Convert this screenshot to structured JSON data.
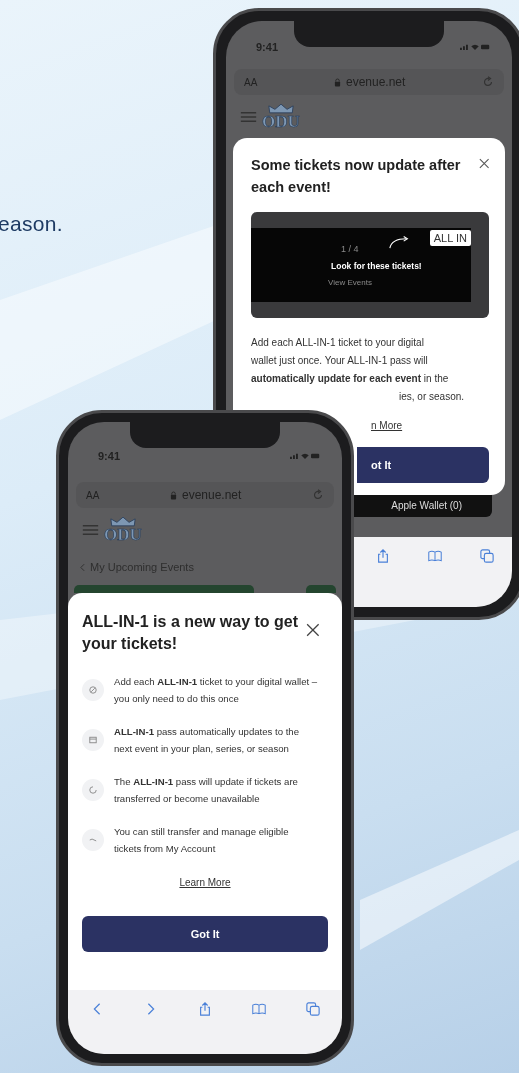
{
  "caption": "eason.",
  "back_phone": {
    "status_time": "9:41",
    "text_size": "AA",
    "url": "evenue.net",
    "logo_text": "ODU",
    "modal": {
      "title": "Some tickets now update after each event!",
      "image": {
        "counter": "1 / 4",
        "badge": "ALL IN",
        "note": "Look for these tickets!",
        "link": "View Events"
      },
      "body_lines": [
        "Add each ALL-IN-1 ticket to your digital",
        "wallet just once. Your ALL-IN-1 pass will",
        "**automatically update for each event** in the"
      ],
      "body_tail": "ies, or season.",
      "learn_more": "n More",
      "button": "ot It"
    },
    "wallet_button": "Apple Wallet (0)"
  },
  "front_phone": {
    "status_time": "9:41",
    "text_size": "AA",
    "url": "evenue.net",
    "logo_text": "ODU",
    "back_link": "My Upcoming Events",
    "modal": {
      "title": "ALL-IN-1 is a new way to get your tickets!",
      "items": [
        "Add each **ALL-IN-1** ticket to your digital wallet – you only need to do this once",
        "**ALL-IN-1** pass automatically updates to the next event in your plan, series, or season",
        "The **ALL-IN-1** pass will update if tickets are transferred or become unavailable",
        "You can still transfer and manage eligible tickets from My Account"
      ],
      "learn_more": "Learn More",
      "button": "Got It"
    }
  }
}
